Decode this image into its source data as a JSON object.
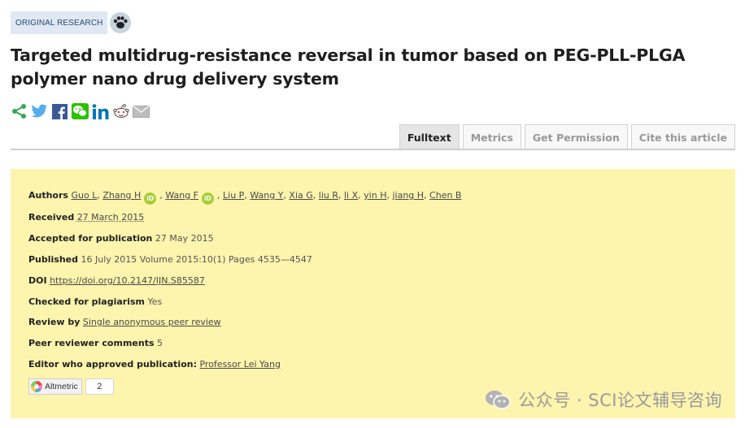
{
  "article": {
    "category": "ORIGINAL RESEARCH",
    "title": "Targeted multidrug-resistance reversal in tumor based on PEG-PLL-PLGA polymer nano drug delivery system"
  },
  "share": {
    "icons": [
      "share-icon",
      "twitter-icon",
      "facebook-icon",
      "wechat-icon",
      "linkedin-icon",
      "reddit-icon",
      "email-icon"
    ]
  },
  "tabs": [
    {
      "label": "Fulltext",
      "active": true
    },
    {
      "label": "Metrics",
      "active": false
    },
    {
      "label": "Get Permission",
      "active": false
    },
    {
      "label": "Cite this article",
      "active": false
    }
  ],
  "meta": {
    "authors_label": "Authors",
    "authors": [
      "Guo L",
      "Zhang H",
      "Wang F",
      "Liu P",
      "Wang Y",
      "Xia G",
      "liu R",
      "li X",
      "yin H",
      "jiang H",
      "Chen B"
    ],
    "orcid_mark": "iD",
    "received_label": "Received",
    "received_value": "27 March 2015",
    "accepted_label": "Accepted for publication",
    "accepted_value": "27 May 2015",
    "published_label": "Published",
    "published_value": "16 July 2015 Volume 2015:10(1) Pages 4535—4547",
    "doi_label": "DOI",
    "doi_value": "https://doi.org/10.2147/IJN.S85587",
    "plagiarism_label": "Checked for plagiarism",
    "plagiarism_value": "Yes",
    "review_label": "Review by",
    "review_value": "Single anonymous peer review",
    "peer_comments_label": "Peer reviewer comments",
    "peer_comments_value": "5",
    "editor_label": "Editor who approved publication:",
    "editor_value": "Professor Lei Yang"
  },
  "altmetric": {
    "label": "Altmetric",
    "score": "2"
  },
  "watermark": {
    "text": "公众号 · SCI论文辅导咨询"
  },
  "colors": {
    "panel_bg": "#fdf4ad",
    "badge_bg": "#dfe8f3",
    "orcid_green": "#a6ce39",
    "share_green": "#3aa655",
    "twitter_blue": "#55acee",
    "facebook_blue": "#3b5998",
    "wechat_green": "#2dc100",
    "linkedin_blue": "#0077b5"
  }
}
